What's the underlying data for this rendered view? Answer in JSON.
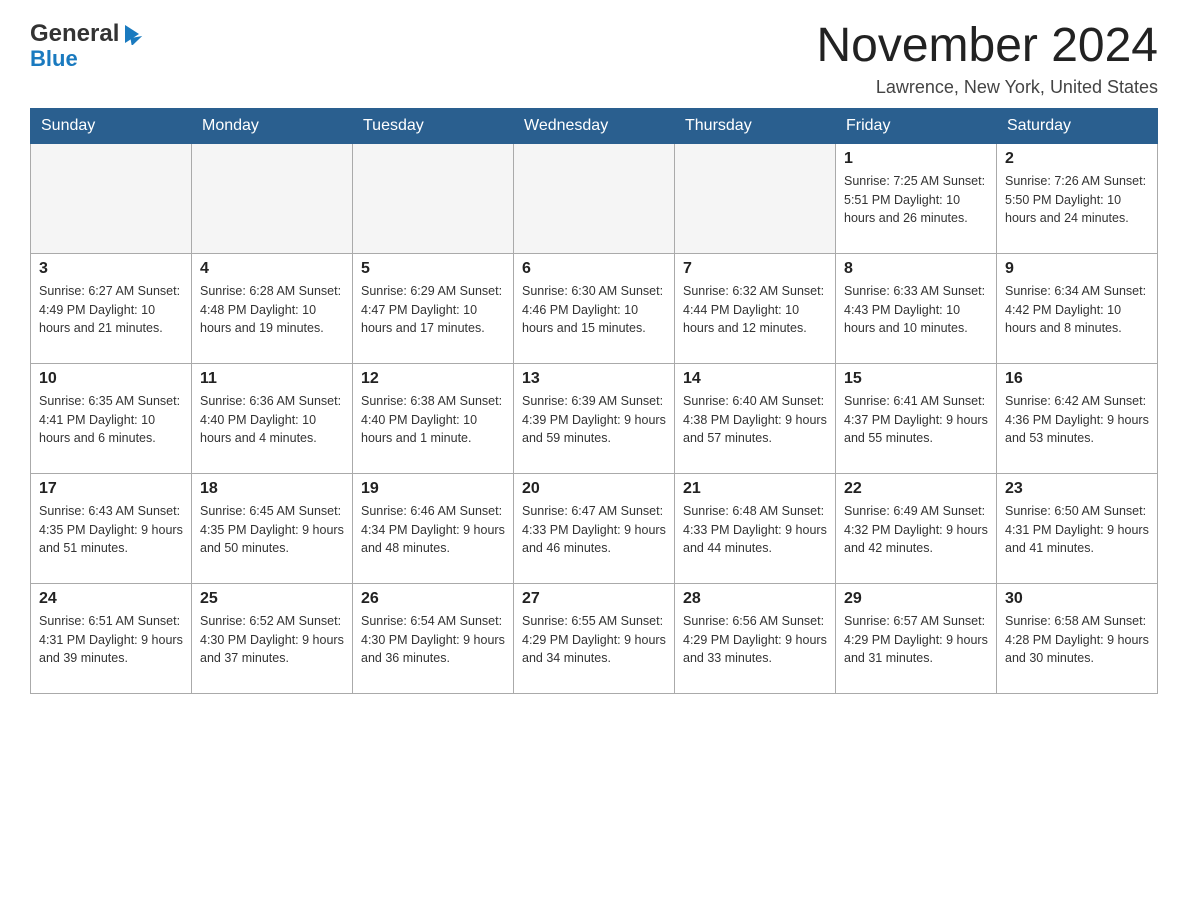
{
  "logo": {
    "general": "General",
    "blue": "Blue"
  },
  "header": {
    "month_year": "November 2024",
    "location": "Lawrence, New York, United States"
  },
  "days_of_week": [
    "Sunday",
    "Monday",
    "Tuesday",
    "Wednesday",
    "Thursday",
    "Friday",
    "Saturday"
  ],
  "weeks": [
    [
      {
        "day": "",
        "info": ""
      },
      {
        "day": "",
        "info": ""
      },
      {
        "day": "",
        "info": ""
      },
      {
        "day": "",
        "info": ""
      },
      {
        "day": "",
        "info": ""
      },
      {
        "day": "1",
        "info": "Sunrise: 7:25 AM\nSunset: 5:51 PM\nDaylight: 10 hours and 26 minutes."
      },
      {
        "day": "2",
        "info": "Sunrise: 7:26 AM\nSunset: 5:50 PM\nDaylight: 10 hours and 24 minutes."
      }
    ],
    [
      {
        "day": "3",
        "info": "Sunrise: 6:27 AM\nSunset: 4:49 PM\nDaylight: 10 hours and 21 minutes."
      },
      {
        "day": "4",
        "info": "Sunrise: 6:28 AM\nSunset: 4:48 PM\nDaylight: 10 hours and 19 minutes."
      },
      {
        "day": "5",
        "info": "Sunrise: 6:29 AM\nSunset: 4:47 PM\nDaylight: 10 hours and 17 minutes."
      },
      {
        "day": "6",
        "info": "Sunrise: 6:30 AM\nSunset: 4:46 PM\nDaylight: 10 hours and 15 minutes."
      },
      {
        "day": "7",
        "info": "Sunrise: 6:32 AM\nSunset: 4:44 PM\nDaylight: 10 hours and 12 minutes."
      },
      {
        "day": "8",
        "info": "Sunrise: 6:33 AM\nSunset: 4:43 PM\nDaylight: 10 hours and 10 minutes."
      },
      {
        "day": "9",
        "info": "Sunrise: 6:34 AM\nSunset: 4:42 PM\nDaylight: 10 hours and 8 minutes."
      }
    ],
    [
      {
        "day": "10",
        "info": "Sunrise: 6:35 AM\nSunset: 4:41 PM\nDaylight: 10 hours and 6 minutes."
      },
      {
        "day": "11",
        "info": "Sunrise: 6:36 AM\nSunset: 4:40 PM\nDaylight: 10 hours and 4 minutes."
      },
      {
        "day": "12",
        "info": "Sunrise: 6:38 AM\nSunset: 4:40 PM\nDaylight: 10 hours and 1 minute."
      },
      {
        "day": "13",
        "info": "Sunrise: 6:39 AM\nSunset: 4:39 PM\nDaylight: 9 hours and 59 minutes."
      },
      {
        "day": "14",
        "info": "Sunrise: 6:40 AM\nSunset: 4:38 PM\nDaylight: 9 hours and 57 minutes."
      },
      {
        "day": "15",
        "info": "Sunrise: 6:41 AM\nSunset: 4:37 PM\nDaylight: 9 hours and 55 minutes."
      },
      {
        "day": "16",
        "info": "Sunrise: 6:42 AM\nSunset: 4:36 PM\nDaylight: 9 hours and 53 minutes."
      }
    ],
    [
      {
        "day": "17",
        "info": "Sunrise: 6:43 AM\nSunset: 4:35 PM\nDaylight: 9 hours and 51 minutes."
      },
      {
        "day": "18",
        "info": "Sunrise: 6:45 AM\nSunset: 4:35 PM\nDaylight: 9 hours and 50 minutes."
      },
      {
        "day": "19",
        "info": "Sunrise: 6:46 AM\nSunset: 4:34 PM\nDaylight: 9 hours and 48 minutes."
      },
      {
        "day": "20",
        "info": "Sunrise: 6:47 AM\nSunset: 4:33 PM\nDaylight: 9 hours and 46 minutes."
      },
      {
        "day": "21",
        "info": "Sunrise: 6:48 AM\nSunset: 4:33 PM\nDaylight: 9 hours and 44 minutes."
      },
      {
        "day": "22",
        "info": "Sunrise: 6:49 AM\nSunset: 4:32 PM\nDaylight: 9 hours and 42 minutes."
      },
      {
        "day": "23",
        "info": "Sunrise: 6:50 AM\nSunset: 4:31 PM\nDaylight: 9 hours and 41 minutes."
      }
    ],
    [
      {
        "day": "24",
        "info": "Sunrise: 6:51 AM\nSunset: 4:31 PM\nDaylight: 9 hours and 39 minutes."
      },
      {
        "day": "25",
        "info": "Sunrise: 6:52 AM\nSunset: 4:30 PM\nDaylight: 9 hours and 37 minutes."
      },
      {
        "day": "26",
        "info": "Sunrise: 6:54 AM\nSunset: 4:30 PM\nDaylight: 9 hours and 36 minutes."
      },
      {
        "day": "27",
        "info": "Sunrise: 6:55 AM\nSunset: 4:29 PM\nDaylight: 9 hours and 34 minutes."
      },
      {
        "day": "28",
        "info": "Sunrise: 6:56 AM\nSunset: 4:29 PM\nDaylight: 9 hours and 33 minutes."
      },
      {
        "day": "29",
        "info": "Sunrise: 6:57 AM\nSunset: 4:29 PM\nDaylight: 9 hours and 31 minutes."
      },
      {
        "day": "30",
        "info": "Sunrise: 6:58 AM\nSunset: 4:28 PM\nDaylight: 9 hours and 30 minutes."
      }
    ]
  ]
}
